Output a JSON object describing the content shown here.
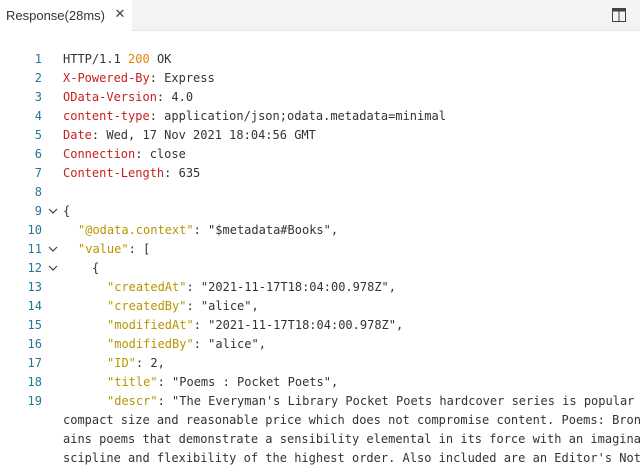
{
  "tab": {
    "label": "Response(28ms)",
    "close_glyph": "✕"
  },
  "icons": {
    "split": "split-editor-icon",
    "fold_open": "chevron-down-icon"
  },
  "colors": {
    "line_number": "#237893",
    "status_code": "#e8820c",
    "header_key": "#c5221f",
    "json_key": "#b89500",
    "text": "#333333"
  },
  "response": {
    "line_numbers": [
      "1",
      "2",
      "3",
      "4",
      "5",
      "6",
      "7",
      "8",
      "9",
      "10",
      "11",
      "12",
      "13",
      "14",
      "15",
      "16",
      "17",
      "18",
      "19"
    ],
    "status": {
      "protocol": "HTTP/1.1 ",
      "code": "200",
      "text": " OK"
    },
    "headers": [
      {
        "key": "X-Powered-By",
        "value": ": Express"
      },
      {
        "key": "OData-Version",
        "value": ": 4.0"
      },
      {
        "key": "content-type",
        "value": ": application/json;odata.metadata=minimal"
      },
      {
        "key": "Date",
        "value": ": Wed, 17 Nov 2021 18:04:56 GMT"
      },
      {
        "key": "Connection",
        "value": ": close"
      },
      {
        "key": "Content-Length",
        "value": ": 635"
      }
    ],
    "body": {
      "open_brace": "{",
      "context_key": "\"@odata.context\"",
      "context_value": ": \"$metadata#Books\",",
      "value_key": "\"value\"",
      "value_open": ": [",
      "item_open": "{",
      "fields": [
        {
          "key": "\"createdAt\"",
          "value": ": \"2021-11-17T18:04:00.978Z\","
        },
        {
          "key": "\"createdBy\"",
          "value": ": \"alice\","
        },
        {
          "key": "\"modifiedAt\"",
          "value": ": \"2021-11-17T18:04:00.978Z\","
        },
        {
          "key": "\"modifiedBy\"",
          "value": ": \"alice\","
        },
        {
          "key": "\"ID\"",
          "value": ": 2,"
        },
        {
          "key": "\"title\"",
          "value": ": \"Poems : Pocket Poets\","
        },
        {
          "key": "\"descr\"",
          "value": ": \"The Everyman's Library Pocket Poets hardcover series is popular f"
        }
      ],
      "descr_wrap": [
        "compact size and reasonable price which does not compromise content. Poems: Bront",
        "ains poems that demonstrate a sensibility elemental in its force with an imaginat",
        "scipline and flexibility of the highest order. Also included are an Editor's Note"
      ]
    }
  }
}
